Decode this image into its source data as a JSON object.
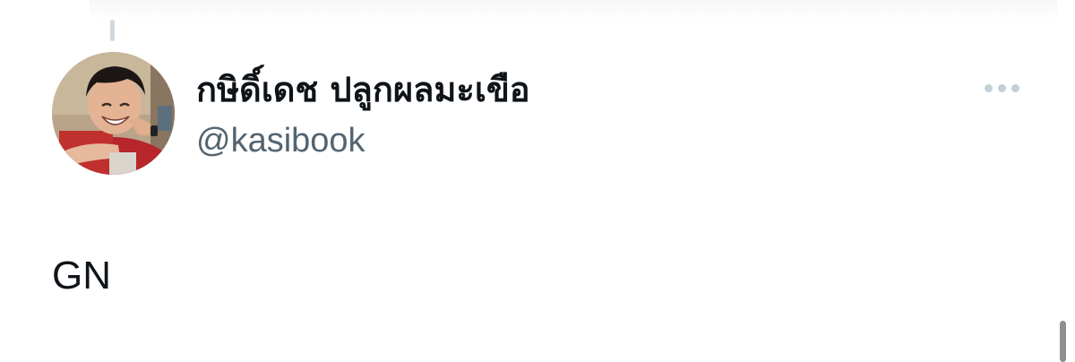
{
  "tweet": {
    "author": {
      "display_name": "กษิดิ์เดช ปลูกผลมะเขือ",
      "handle": "@kasibook",
      "avatar_icon": "profile-photo"
    },
    "text": "GN",
    "more_icon": "more-horizontal-icon"
  },
  "colors": {
    "name": "#0f1419",
    "handle": "#536471",
    "more_dots": "#c4cfd6",
    "thread_line": "#cfd9de"
  }
}
